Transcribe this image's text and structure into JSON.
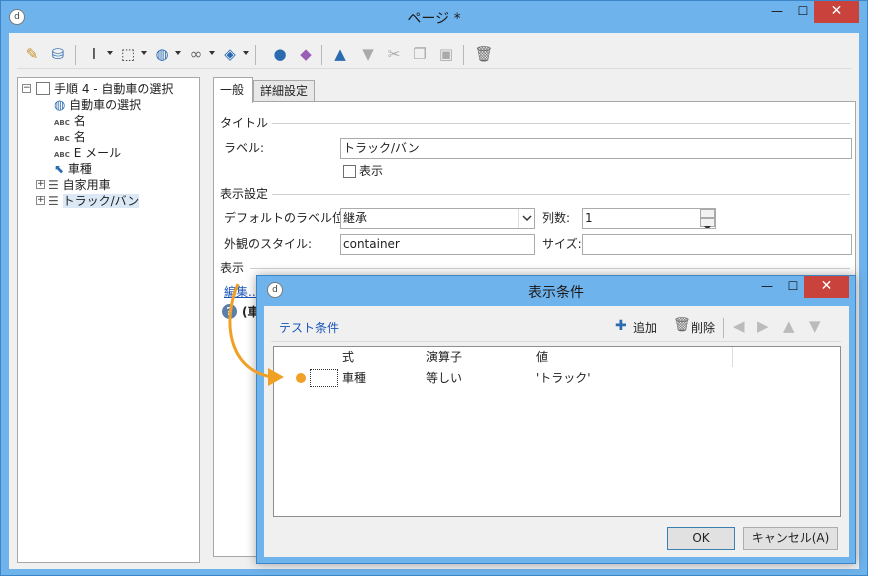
{
  "main_window": {
    "title": "ページ *",
    "minimize": "—",
    "maximize": "☐",
    "close": "✕"
  },
  "tree": {
    "root_label": "手順 4 - 自動車の選択",
    "items": [
      {
        "label": "自動車の選択",
        "icon": "globe-icon"
      },
      {
        "label": "名",
        "icon": "abc-text-icon",
        "prefix": "ABC"
      },
      {
        "label": "名",
        "icon": "abc-text-icon",
        "prefix": "ABC"
      },
      {
        "label": "E メール",
        "icon": "abc-text-icon",
        "prefix": "ABC"
      },
      {
        "label": "車種",
        "icon": "cursor-select-icon"
      },
      {
        "label": "自家用車",
        "icon": "list-icon"
      },
      {
        "label": "トラック/バン",
        "icon": "list-icon"
      }
    ]
  },
  "tabs": [
    {
      "label": "一般",
      "active": true
    },
    {
      "label": "詳細設定",
      "active": false
    }
  ],
  "general": {
    "title_section": "タイトル",
    "label_caption": "ラベル:",
    "label_value": "トラック/バン",
    "show_checkbox": "表示",
    "display_section": "表示設定",
    "default_label_position_caption": "デフォルトのラベル位置:",
    "default_label_position_value": "継承",
    "columns_caption": "列数:",
    "columns_value": "1",
    "appearance_style_caption": "外観のスタイル:",
    "appearance_style_value": "container",
    "size_caption": "サイズ:",
    "size_value": "",
    "visibility_section": "表示",
    "edit_link": "編集...",
    "info_text": "(車種"
  },
  "dialog": {
    "title": "表示条件",
    "minimize": "—",
    "maximize": "☐",
    "close": "✕",
    "toolbar_title": "テスト条件",
    "add_label": "追加",
    "delete_label": "削除",
    "columns": [
      "式",
      "演算子",
      "値"
    ],
    "rows": [
      {
        "expression": "車種",
        "operator": "等しい",
        "value": "'トラック'"
      }
    ],
    "ok_label": "OK",
    "cancel_label": "キャンセル(A)"
  },
  "colors": {
    "title_bar": "#6fb3ec",
    "close_button": "#c9423b",
    "link": "#1a56b8",
    "annotation_arrow": "#f0a024"
  }
}
